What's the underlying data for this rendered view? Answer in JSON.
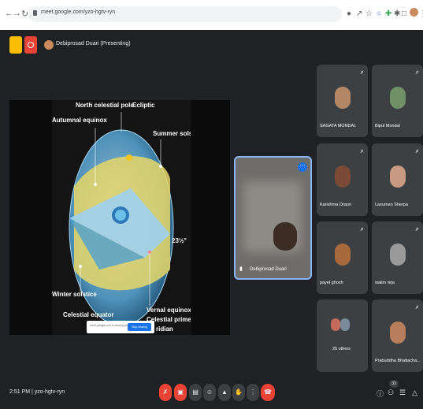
{
  "browser": {
    "url": "meet.google.com/yzo-hgtv-ryn"
  },
  "topbar": {
    "presenter_title": "Debiprosad Duari (Presenting)"
  },
  "slide": {
    "labels": {
      "north_pole": "North celestial pole",
      "ecliptic": "Ecliptic",
      "autumnal": "Autumnal equinox",
      "summer": "Summer solstice",
      "angle": "23",
      "winter": "Winter solstice",
      "vernal": "Vernal equinox",
      "prime": "Celestial prime",
      "meridian": "ridian",
      "equator": "Celestial equator"
    },
    "join_text": "meet.google.com is sharing your screen.",
    "join_button": "Stop sharing"
  },
  "selfview": {
    "name": "Debiprosad Duari"
  },
  "tiles": [
    {
      "name": "SAGATA MONDAL"
    },
    {
      "name": "Bipul Mondal"
    },
    {
      "name": "Karishma Oraon"
    },
    {
      "name": "Laxuman Sherpa"
    },
    {
      "name": "payel ghosh"
    },
    {
      "name": "waiim reja"
    },
    {
      "name": "25 others"
    },
    {
      "name": "Prabuddha Bhattacha..."
    }
  ],
  "bottombar": {
    "meeting_info": "2:51 PM  |  yzo-hgtv-ryn",
    "people_count": "33"
  }
}
